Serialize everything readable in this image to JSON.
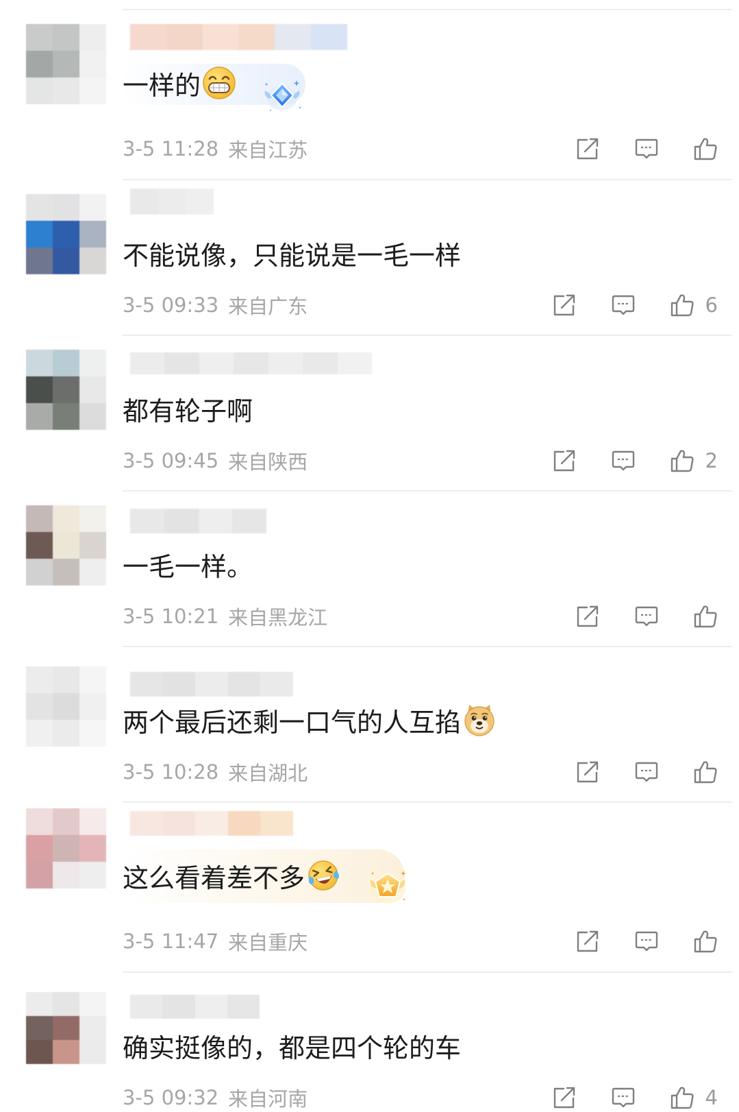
{
  "comments": [
    {
      "avatar_colors": [
        "#c9cbca",
        "#c4c6c5",
        "#eeeeee",
        "#a2a8a5",
        "#b4b8b6",
        "#f1f1f1",
        "#e4e5e5",
        "#e8e8e8",
        "#f4f4f4"
      ],
      "name_colors": [
        "#f6d9cd",
        "#f4d6c8",
        "#f8e1d4",
        "#f5dac9",
        "#e4e8f1",
        "#d8e3f5"
      ],
      "text": "一样的",
      "emoji": "grinning-face-emoji-icon",
      "badge": "blue-diamond-badge-icon",
      "date": "3-5 11:28",
      "location": "来自江苏"
    },
    {
      "avatar_colors": [
        "#e4e4e4",
        "#e2e1e3",
        "#f2f2f2",
        "#2d7fd0",
        "#2e5fae",
        "#aab3c2",
        "#6f7790",
        "#3459a1",
        "#d9d6d6"
      ],
      "name_colors": [
        "#e9e9e9",
        "#ececec",
        "#efefef"
      ],
      "text": "不能说像，只能说是一毛一样",
      "date": "3-5 09:33",
      "location": "来自广东",
      "likes": "6"
    },
    {
      "avatar_colors": [
        "#cbd8de",
        "#b8ccd6",
        "#eef0f0",
        "#4b4f4c",
        "#6b6e6a",
        "#e8e8e8",
        "#a9aba8",
        "#787f77",
        "#dcdcdc"
      ],
      "name_colors": [
        "#ececec",
        "#e5e5e5",
        "#efefef",
        "#e7e7e7",
        "#eeeeee",
        "#e9e9e9",
        "#f1f1f1"
      ],
      "text": "都有轮子啊",
      "date": "3-5 09:45",
      "location": "来自陕西",
      "likes": "2"
    },
    {
      "avatar_colors": [
        "#c5b9b7",
        "#efe9dc",
        "#f3f1ec",
        "#6d5a55",
        "#ece6d7",
        "#d9d4cf",
        "#d1d1d1",
        "#c4bfba",
        "#eeeeee"
      ],
      "name_colors": [
        "#e8e8e8",
        "#e3e3e3",
        "#eeeeee",
        "#e6e6e6"
      ],
      "text": "一毛一样。",
      "date": "3-5 10:21",
      "location": "来自黑龙江"
    },
    {
      "avatar_colors": [
        "#ececec",
        "#e8e8e8",
        "#f5f5f5",
        "#e3e3e3",
        "#dcdcdc",
        "#f0f0f0",
        "#f0f0f0",
        "#ebebeb",
        "#f6f6f6"
      ],
      "name_colors": [
        "#e6e6e6",
        "#e2e2e2",
        "#ececec",
        "#e4e4e4",
        "#eaeaea"
      ],
      "text": "两个最后还剩一口气的人互掐",
      "emoji": "doge-emoji-icon",
      "date": "3-5 10:28",
      "location": "来自湖北"
    },
    {
      "avatar_colors": [
        "#efdcdc",
        "#e3c9c9",
        "#f6eaea",
        "#d9a1a4",
        "#cfb4b4",
        "#e4b5b7",
        "#d3a2a6",
        "#efe8ea",
        "#eeeeee"
      ],
      "name_colors": [
        "#f8e6e0",
        "#f7e3dd",
        "#f9ece4",
        "#f7d9bf",
        "#f9e4cc"
      ],
      "text": "这么看着差不多",
      "emoji": "laughing-tears-emoji-icon",
      "badge": "gold-star-badge-icon",
      "date": "3-5 11:47",
      "location": "来自重庆"
    },
    {
      "avatar_colors": [
        "#ececec",
        "#e5e5e5",
        "#f4f4f4",
        "#74625f",
        "#936b66",
        "#ececec",
        "#6e5650",
        "#c9958a",
        "#ebebeb"
      ],
      "name_colors": [
        "#eaeaea",
        "#e4e4e4",
        "#eeeeee",
        "#e6e6e6"
      ],
      "text": "确实挺像的，都是四个轮的车",
      "date": "3-5 09:32",
      "location": "来自河南",
      "likes": "4"
    }
  ],
  "actions": {
    "share_icon": "share-icon",
    "reply_icon": "comment-icon",
    "like_icon": "thumbs-up-icon"
  },
  "colors": {
    "text": "#1c1c1c",
    "meta": "#a6a6a6",
    "icon": "#7f7f7f",
    "divider": "#ededed"
  }
}
